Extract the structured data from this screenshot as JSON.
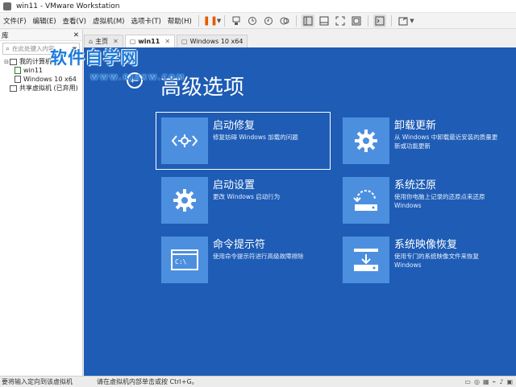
{
  "window": {
    "title": "win11 - VMware Workstation"
  },
  "menu": [
    "文件(F)",
    "编辑(E)",
    "查看(V)",
    "虚拟机(M)",
    "选项卡(T)",
    "帮助(H)"
  ],
  "sidebar": {
    "header": "库",
    "search_placeholder": "在此处键入内容...",
    "tree": [
      {
        "label": "我的计算机",
        "level": 1
      },
      {
        "label": "win11",
        "level": 2
      },
      {
        "label": "Windows 10 x64",
        "level": 2
      },
      {
        "label": "共享虚拟机 (已弃用)",
        "level": 1
      }
    ]
  },
  "tabs": [
    {
      "label": "主页"
    },
    {
      "label": "win11"
    },
    {
      "label": "Windows 10 x64"
    }
  ],
  "vm": {
    "title": "高级选项",
    "options": [
      {
        "name": "启动修复",
        "desc": "修复妨碍 Windows 加载的问题",
        "icon": "startup-repair-icon"
      },
      {
        "name": "卸载更新",
        "desc": "从 Windows 中卸载最近安装的质量更新或功能更新",
        "icon": "gear-icon"
      },
      {
        "name": "启动设置",
        "desc": "更改 Windows 启动行为",
        "icon": "gear-icon"
      },
      {
        "name": "系统还原",
        "desc": "使用你电脑上记录的还原点来还原 Windows",
        "icon": "system-restore-icon"
      },
      {
        "name": "命令提示符",
        "desc": "使用命令提示符进行高级故障排除",
        "icon": "command-prompt-icon",
        "prompt": "C:\\"
      },
      {
        "name": "系统映像恢复",
        "desc": "使用专门的系统映像文件来恢复 Windows",
        "icon": "image-recovery-icon"
      }
    ]
  },
  "watermark": {
    "text": "软件自学网",
    "url": "WWW.RJZXW.COM"
  },
  "statusbar": {
    "left": "要将输入定向到该虚拟机",
    "main": "请在虚拟机内部单击或按 Ctrl+G。"
  },
  "colors": {
    "vm_background": "#1e5cb5",
    "tile": "#4d8fdf",
    "pause_accent": "#e45a00"
  }
}
